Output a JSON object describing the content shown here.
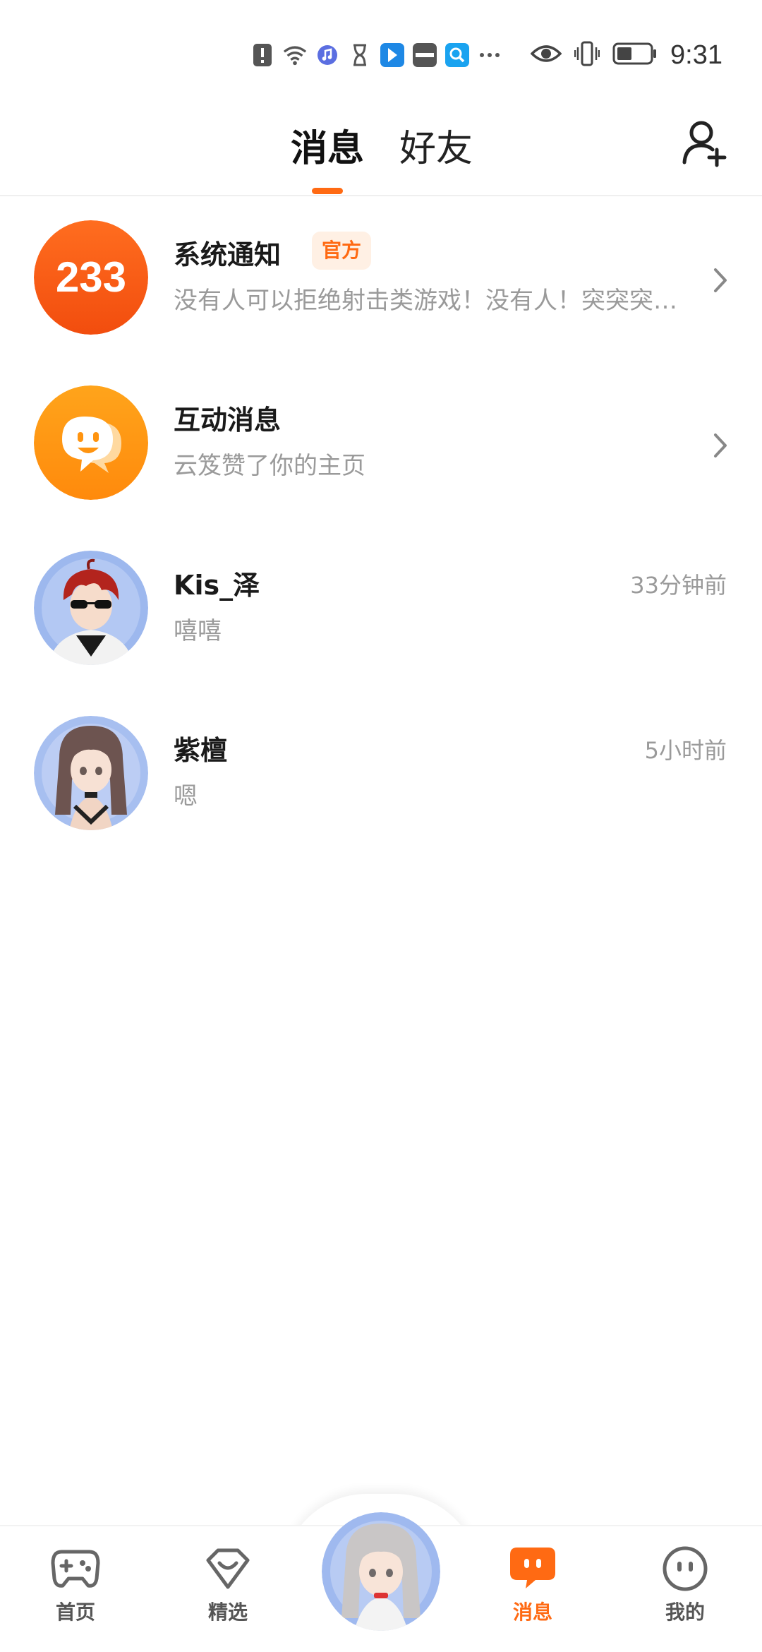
{
  "status_bar": {
    "time": "9:31",
    "icons": [
      "alert-icon",
      "wifi-icon",
      "music-icon",
      "hourglass-icon",
      "app-blue-icon",
      "huawei-icon",
      "search-app-icon",
      "more-icon"
    ],
    "right_icons": [
      "eye-icon",
      "vibrate-icon",
      "battery-icon"
    ]
  },
  "tabs": {
    "messages": "消息",
    "friends": "好友"
  },
  "messages": [
    {
      "title": "系统通知",
      "badge": "官方",
      "preview": "没有人可以拒绝射击类游戏！没有人！突突突…",
      "avatar_text": "233",
      "time": ""
    },
    {
      "title": "互动消息",
      "preview": "云笈赞了你的主页",
      "time": ""
    },
    {
      "title": "Kis_泽",
      "preview": "嘻嘻",
      "time": "33分钟前"
    },
    {
      "title": "紫檀",
      "preview": "嗯",
      "time": "5小时前"
    }
  ],
  "bottom_nav": {
    "home": "首页",
    "featured": "精选",
    "messages": "消息",
    "mine": "我的"
  },
  "colors": {
    "accent": "#ff6a13",
    "muted_text": "#9a9a9a",
    "title_text": "#1a1a1a"
  }
}
